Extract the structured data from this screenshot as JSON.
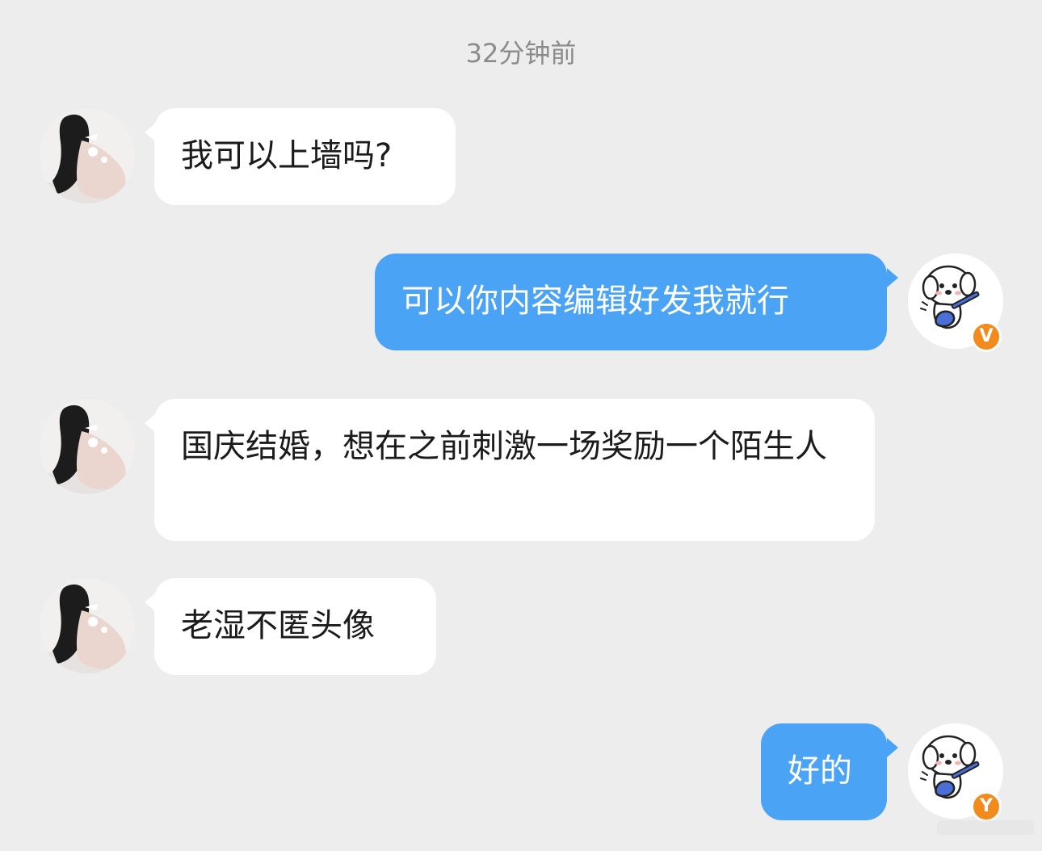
{
  "timestamp": "32分钟前",
  "messages": [
    {
      "side": "left",
      "text": "我可以上墙吗?"
    },
    {
      "side": "right",
      "text": "可以你内容编辑好发我就行",
      "badge": "V"
    },
    {
      "side": "left",
      "text": "国庆结婚，想在之前刺激一场奖励一个陌生人"
    },
    {
      "side": "left",
      "text": "老湿不匿头像"
    },
    {
      "side": "right",
      "text": "好的",
      "badge": "Y"
    }
  ],
  "icons": {
    "left_avatar": "user-photo-avatar",
    "right_avatar": "dog-playing-guitar-avatar",
    "badge": "verified-badge-icon"
  },
  "colors": {
    "background": "#ededed",
    "incoming_bubble": "#ffffff",
    "outgoing_bubble": "#4aa3f4",
    "badge": "#f28a1c"
  }
}
